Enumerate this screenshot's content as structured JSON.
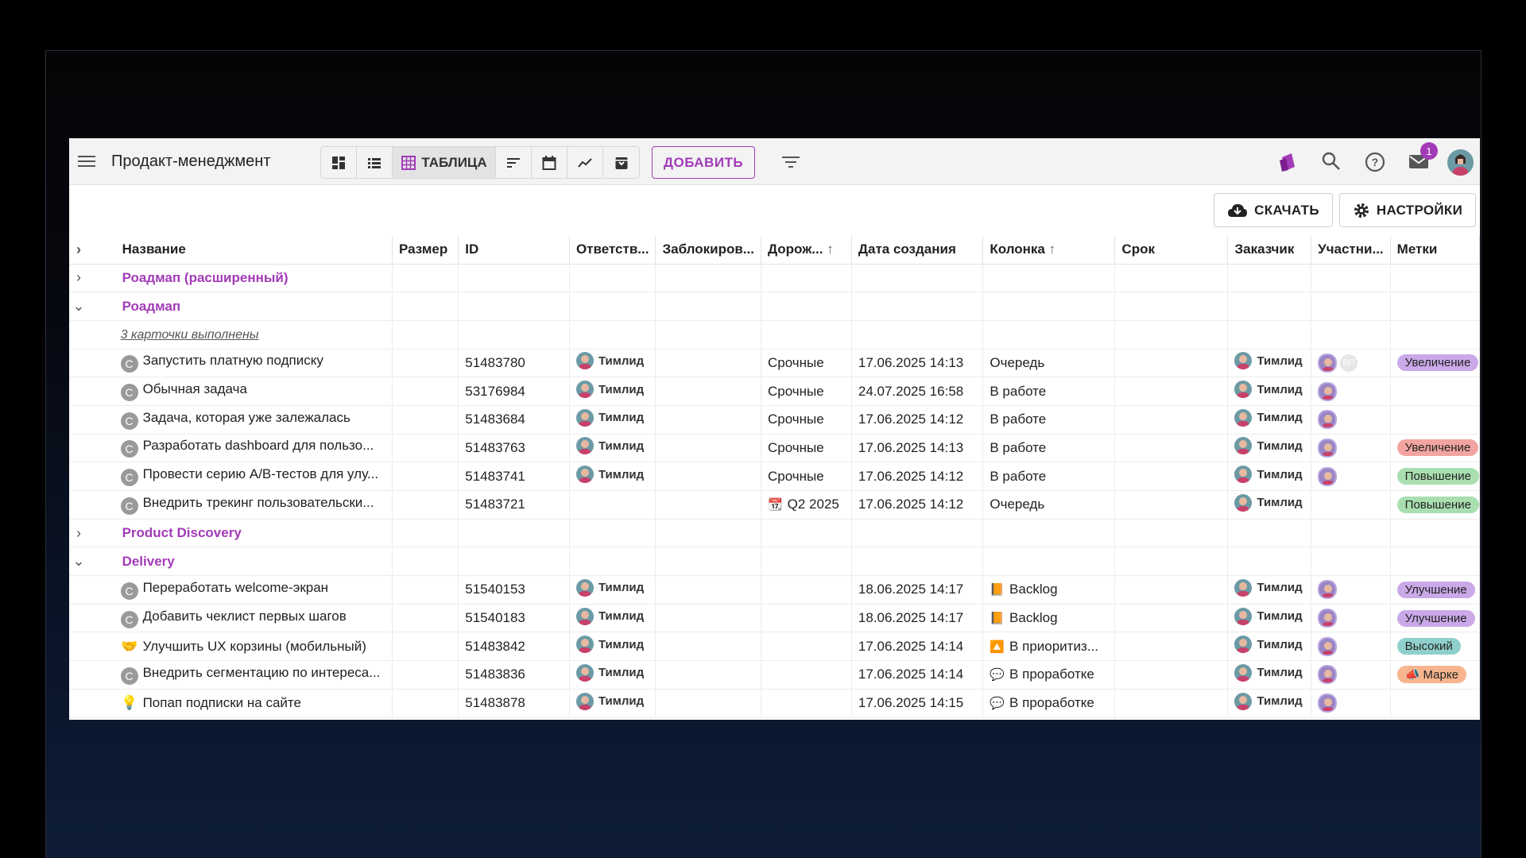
{
  "app": {
    "title": "Продакт-менеджмент",
    "active_view_label": "ТАБЛИЦА",
    "add_label": "ДОБАВИТЬ",
    "notifications_count": "1",
    "accent": "#a23bb7"
  },
  "actions": {
    "download_label": "СКАЧАТЬ",
    "settings_label": "НАСТРОЙКИ"
  },
  "columns": [
    "Название",
    "Размер",
    "ID",
    "Ответств...",
    "Заблокиров...",
    "Дорож...",
    "Дата создания",
    "Колонка",
    "Срок",
    "Заказчик",
    "Участни...",
    "Метки"
  ],
  "groups": {
    "roadmap_ext": "Роадмап (расширенный)",
    "roadmap": "Роадмап",
    "roadmap_done": "3 карточки выполнены",
    "discovery": "Product Discovery",
    "delivery": "Delivery"
  },
  "roadmap_rows": [
    {
      "icon": "C",
      "name": "Запустить платную подписку",
      "id": "51483780",
      "resp": "Тимлид",
      "road": "Срочные",
      "date": "17.06.2025 14:13",
      "col": "Очередь",
      "col_icon": "",
      "cust": "Тимлид",
      "vp": "ВП",
      "tag": "Увеличение",
      "tag_color": "#c9a9e8"
    },
    {
      "icon": "C",
      "name": "Обычная задача",
      "id": "53176984",
      "resp": "Тимлид",
      "road": "Срочные",
      "date": "24.07.2025 16:58",
      "col": "В работе",
      "col_icon": "",
      "cust": "Тимлид",
      "vp": "",
      "tag": "",
      "tag_color": ""
    },
    {
      "icon": "C",
      "name": "Задача, которая уже залежалась",
      "id": "51483684",
      "resp": "Тимлид",
      "road": "Срочные",
      "date": "17.06.2025 14:12",
      "col": "В работе",
      "col_icon": "",
      "cust": "Тимлид",
      "vp": "",
      "tag": "",
      "tag_color": ""
    },
    {
      "icon": "C",
      "name": "Разработать dashboard для пользо...",
      "id": "51483763",
      "resp": "Тимлид",
      "road": "Срочные",
      "date": "17.06.2025 14:13",
      "col": "В работе",
      "col_icon": "",
      "cust": "Тимлид",
      "vp": "",
      "tag": "Увеличение",
      "tag_color": "#f2a5a0"
    },
    {
      "icon": "C",
      "name": "Провести серию A/B-тестов для улу...",
      "id": "51483741",
      "resp": "Тимлид",
      "road": "Срочные",
      "date": "17.06.2025 14:12",
      "col": "В работе",
      "col_icon": "",
      "cust": "Тимлид",
      "vp": "",
      "tag": "Повышение",
      "tag_color": "#a9dfb0"
    },
    {
      "icon": "C",
      "name": "Внедрить трекинг пользовательски...",
      "id": "51483721",
      "resp": "",
      "road": "Q2 2025",
      "road_icon": "📆",
      "date": "17.06.2025 14:12",
      "col": "Очередь",
      "col_icon": "",
      "cust": "Тимлид",
      "vp": "",
      "noPart": true,
      "tag": "Повышение",
      "tag_color": "#a9dfb0"
    }
  ],
  "delivery_rows": [
    {
      "icon": "C",
      "name": "Переработать welcome-экран",
      "id": "51540153",
      "resp": "Тимлид",
      "road": "",
      "date": "18.06.2025 14:17",
      "col": "Backlog",
      "col_icon": "📙",
      "cust": "Тимлид",
      "vp": "",
      "tag": "Улучшение",
      "tag_color": "#c9a9e8"
    },
    {
      "icon": "C",
      "name": "Добавить чеклист первых шагов",
      "id": "51540183",
      "resp": "Тимлид",
      "road": "",
      "date": "18.06.2025 14:17",
      "col": "Backlog",
      "col_icon": "📙",
      "cust": "Тимлид",
      "vp": "",
      "tag": "Улучшение",
      "tag_color": "#c9a9e8"
    },
    {
      "icon": "🤝",
      "name": "Улучшить UX корзины (мобильный)",
      "id": "51483842",
      "resp": "Тимлид",
      "road": "",
      "date": "17.06.2025 14:14",
      "col": "В приоритиз...",
      "col_icon": "🔼",
      "cust": "Тимлид",
      "vp": "",
      "tag": "Высокий",
      "tag_color": "#8fd0cc"
    },
    {
      "icon": "C",
      "name": "Внедрить сегментацию по интереса...",
      "id": "51483836",
      "resp": "Тимлид",
      "road": "",
      "date": "17.06.2025 14:14",
      "col": "В проработке",
      "col_icon": "💬",
      "cust": "Тимлид",
      "vp": "",
      "tag": "📣 Марке",
      "tag_color": "#f6b58f"
    },
    {
      "icon": "💡",
      "name": "Попап подписки на сайте",
      "id": "51483878",
      "resp": "Тимлид",
      "road": "",
      "date": "17.06.2025 14:15",
      "col": "В проработке",
      "col_icon": "💬",
      "cust": "Тимлид",
      "vp": "",
      "tag": "",
      "tag_color": ""
    }
  ]
}
